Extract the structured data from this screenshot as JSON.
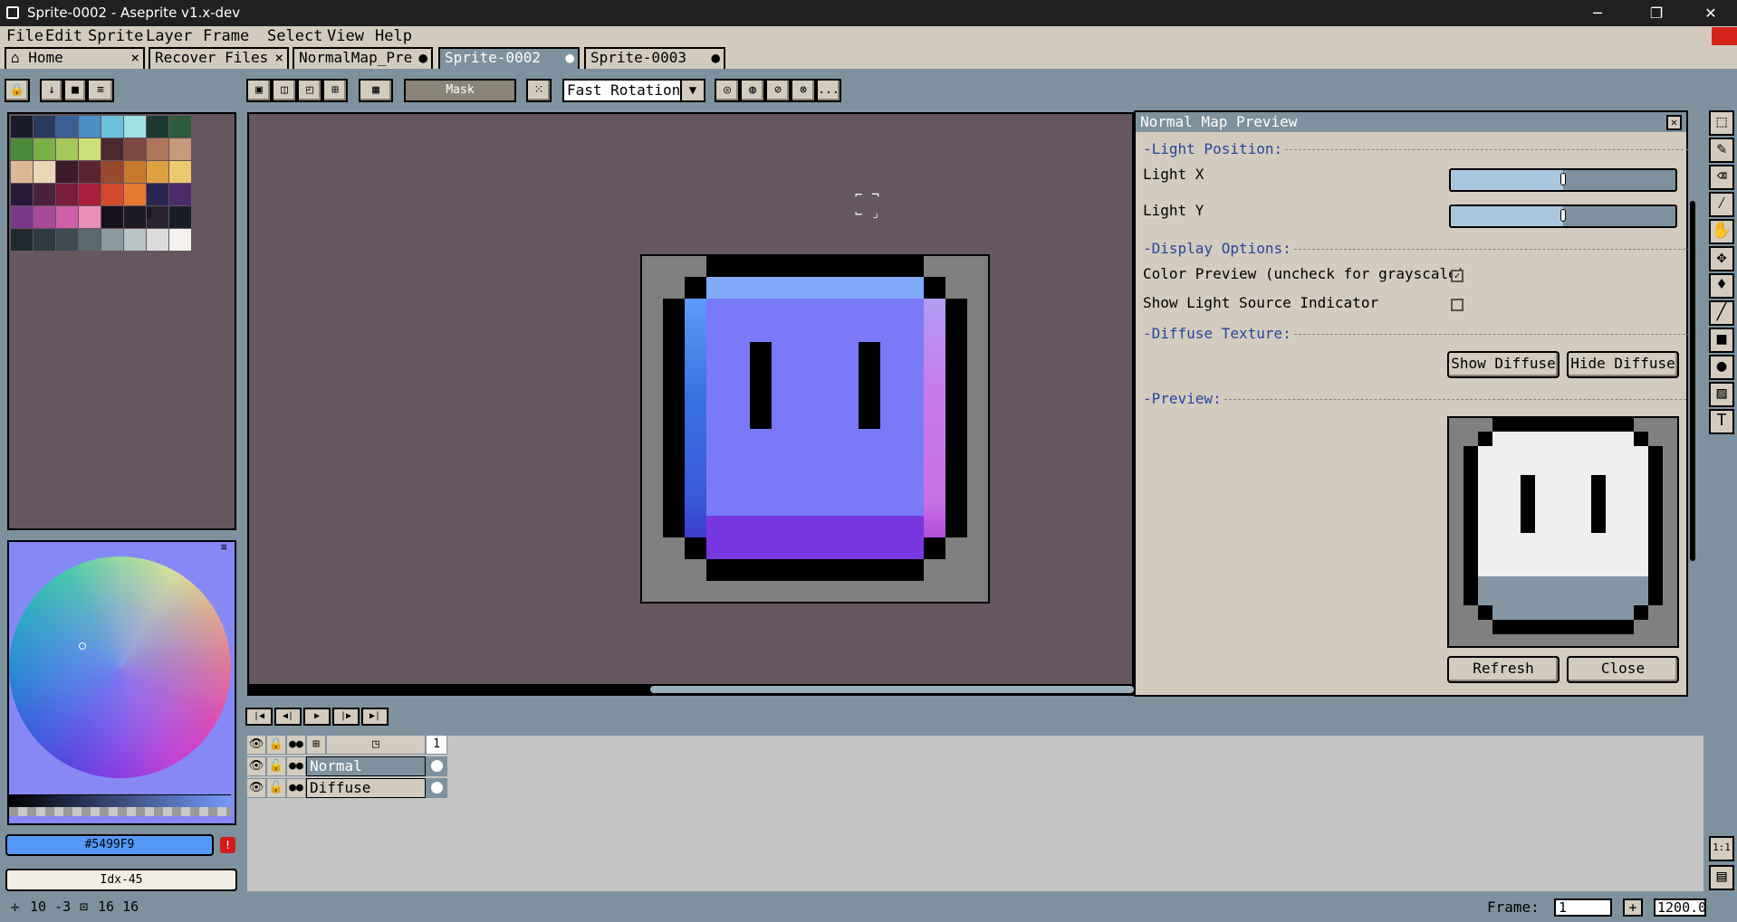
{
  "window": {
    "title": "Sprite-0002 - Aseprite v1.x-dev",
    "minimize": "─",
    "maximize": "❐",
    "close": "✕"
  },
  "menu": [
    "File",
    "Edit",
    "Sprite",
    "Layer",
    "Frame",
    "Select",
    "View",
    "Help"
  ],
  "tabs": [
    {
      "label": "Home",
      "marker": "×"
    },
    {
      "label": "Recover Files",
      "marker": "×"
    },
    {
      "label": "NormalMap_Pre",
      "marker": "●"
    },
    {
      "label": "Sprite-0002",
      "marker": "●"
    },
    {
      "label": "Sprite-0003",
      "marker": "●"
    }
  ],
  "toolbar": {
    "mask_label": "Mask",
    "rotation_value": "Fast Rotation",
    "more_label": "..."
  },
  "palette": {
    "colors": [
      "#1a1c2c",
      "#283a5e",
      "#3a5f94",
      "#4f8ec4",
      "#6cc1dc",
      "#9fe0e6",
      "#1e3a30",
      "#2e5b3a",
      "#4c8a3c",
      "#7ab04a",
      "#a4c85a",
      "#cce07a",
      "#4a2a30",
      "#7c4a42",
      "#b0765a",
      "#c69a7a",
      "#dab896",
      "#e8d8b8",
      "#3a1c2a",
      "#5a2430",
      "#9a4a2c",
      "#c87a2c",
      "#e0a040",
      "#ecc870",
      "#2a1a3a",
      "#4a2240",
      "#7a1c3c",
      "#a8203c",
      "#d44a2c",
      "#e87a30",
      "#2c2450",
      "#4a2c6a",
      "#7a3a8a",
      "#a84a9a",
      "#d060a8",
      "#e890b8",
      "#16121c",
      "#1e1a24",
      "#2a2432",
      "#181e26",
      "#222a30",
      "#2e3a40",
      "#3e4a52",
      "#5c6a70",
      "#8a9a9e",
      "#b8c4c4",
      "#dcdcdc",
      "#f4f2ee"
    ]
  },
  "color": {
    "hex": "#5499F9",
    "index": "Idx-45",
    "warning": "!"
  },
  "dialog": {
    "title": "Normal Map Preview",
    "close_glyph": "✕",
    "light_position": "-Light Position:",
    "light_x_label": "Light X",
    "light_y_label": "Light Y",
    "light_x_value": 0.5,
    "light_y_value": 0.5,
    "display_options": "-Display Options:",
    "color_preview_label": "Color Preview (uncheck for grayscale)",
    "color_preview_checked": true,
    "show_light_label": "Show Light Source Indicator",
    "show_light_checked": false,
    "diffuse_texture": "-Diffuse Texture:",
    "show_diffuse": "Show Diffuse",
    "hide_diffuse": "Hide Diffuse",
    "preview": "-Preview:",
    "refresh": "Refresh",
    "close": "Close",
    "check_glyph": "✓"
  },
  "timeline": {
    "frame_number": "1",
    "layers": [
      {
        "name": "Normal",
        "selected": true
      },
      {
        "name": "Diffuse",
        "selected": false
      }
    ]
  },
  "status": {
    "position": "10 -3",
    "size": "16 16",
    "frame_label": "Frame:",
    "frame_value": "1",
    "zoom_value": "1200.0",
    "add_frame": "+"
  },
  "tools_right_bottom": [
    "1:1"
  ]
}
